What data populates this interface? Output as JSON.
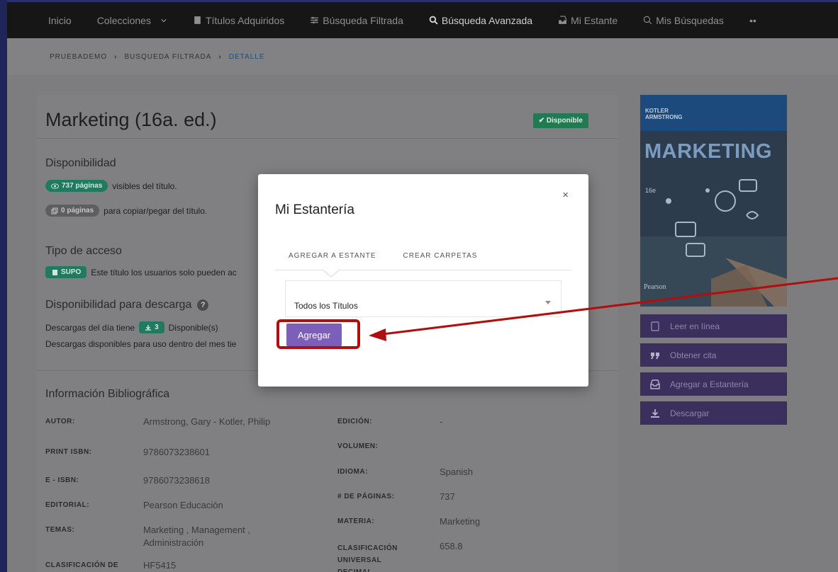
{
  "navbar": {
    "items": [
      {
        "label": "Inicio",
        "icon": ""
      },
      {
        "label": "Colecciones",
        "icon": "chevron-down-icon"
      },
      {
        "label": "Títulos Adquiridos",
        "icon": "book-icon"
      },
      {
        "label": "Búsqueda Filtrada",
        "icon": "sliders-icon"
      },
      {
        "label": "Búsqueda Avanzada",
        "icon": "search-icon"
      },
      {
        "label": "Mi Estante",
        "icon": "inbox-icon"
      },
      {
        "label": "Mis Búsquedas",
        "icon": "search-icon"
      },
      {
        "label": "••",
        "icon": ""
      }
    ]
  },
  "breadcrumb": {
    "items": [
      "PRUEBADEMO",
      "BUSQUEDA FILTRADA",
      "DETALLE"
    ],
    "sep": "›"
  },
  "book": {
    "title": "Marketing (16a. ed.)",
    "status": "Disponible",
    "availability": {
      "heading": "Disponibilidad",
      "pages_visible_badge": "737 páginas",
      "pages_visible_text": "visibles del título.",
      "pages_copy_badge": "0 páginas",
      "pages_copy_text": "para copiar/pegar del título."
    },
    "access": {
      "heading": "Tipo de acceso",
      "badge": "SUPO",
      "text": "Este título los usuarios solo pueden ac"
    },
    "download": {
      "heading": "Disponibilidad para descarga",
      "help": "?",
      "daily_prefix": "Descargas del día tiene",
      "daily_count": "3",
      "daily_suffix": "Disponible(s)",
      "monthly": "Descargas disponibles para uso dentro del mes tie"
    }
  },
  "biblio": {
    "heading": "Información Bibliográfica",
    "left": [
      {
        "label": "AUTOR:",
        "value": "Armstrong, Gary - Kotler, Philip"
      },
      {
        "label": "PRINT ISBN:",
        "value": "9786073238601"
      },
      {
        "label": "E - ISBN:",
        "value": "9786073238618"
      },
      {
        "label": "EDITORIAL:",
        "value": "Pearson Educación"
      },
      {
        "label": "TEMAS:",
        "value": "Marketing , Management , Administración"
      },
      {
        "label": "CLASIFICACIÓN DE",
        "value": "HF5415"
      }
    ],
    "right": [
      {
        "label": "EDICIÓN:",
        "value": "-"
      },
      {
        "label": "VOLUMEN:",
        "value": ""
      },
      {
        "label": "IDIOMA:",
        "value": "Spanish"
      },
      {
        "label": "# DE PÁGINAS:",
        "value": "737"
      },
      {
        "label": "MATERIA:",
        "value": "Marketing"
      },
      {
        "label": "CLASIFICACIÓN UNIVERSAL DECIMAL",
        "value": "658.8"
      }
    ]
  },
  "cover": {
    "authors_1": "KOTLER",
    "authors_2": "ARMSTRONG",
    "title": "MARKETING",
    "edition": "16e",
    "publisher": "Pearson"
  },
  "actions": [
    {
      "label": "Leer en línea",
      "icon": "tablet-icon"
    },
    {
      "label": "Obtener cita",
      "icon": "quote-icon"
    },
    {
      "label": "Agregar a Estantería",
      "icon": "inbox-icon"
    },
    {
      "label": "Descargar",
      "icon": "download-icon"
    }
  ],
  "modal": {
    "title": "Mi Estantería",
    "close": "×",
    "tabs": [
      "AGREGAR A ESTANTE",
      "CREAR CARPETAS"
    ],
    "select_value": "Todos los Títulos",
    "add_label": "Agregar"
  },
  "colors": {
    "accent": "#7b5fb9",
    "success": "#217a52",
    "annotation": "#b00f0f",
    "navbar": "#161617"
  }
}
